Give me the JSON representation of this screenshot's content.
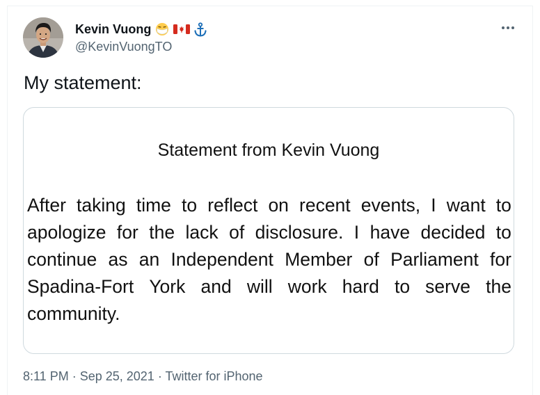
{
  "tweet": {
    "author": {
      "display_name": "Kevin Vuong",
      "handle": "@KevinVuongTO",
      "badges": [
        "face-with-medical-mask-icon",
        "canada-flag-icon",
        "anchor-icon"
      ]
    },
    "more_icon": "more-horizontal-icon",
    "text": "My statement:",
    "image": {
      "title": "Statement from Kevin Vuong",
      "lines": [
        [
          "After",
          "taking",
          "time",
          "to",
          "reflect",
          "on",
          "recent",
          "events,",
          "I",
          "want",
          "to"
        ],
        [
          "apologize",
          "for",
          "the",
          "lack",
          "of",
          "disclosure.",
          "I",
          "have",
          "decided",
          "to"
        ],
        [
          "continue",
          "as",
          "an",
          "Independent",
          "Member",
          "of",
          "Parliament",
          "for"
        ],
        [
          "Spadina-Fort",
          "York",
          "and",
          "will",
          "work",
          "hard",
          "to",
          "serve",
          "the"
        ],
        [
          "community."
        ]
      ]
    },
    "meta": {
      "time": "8:11 PM",
      "separator": " · ",
      "date": "Sep 25, 2021",
      "source": "Twitter for iPhone"
    }
  },
  "colors": {
    "text_primary": "#0f1419",
    "text_secondary": "#536471",
    "border": "#cfd9de",
    "canada_red": "#d52b1e",
    "anchor_blue": "#1d6fb8",
    "mask_yellow": "#ffcc4d"
  }
}
